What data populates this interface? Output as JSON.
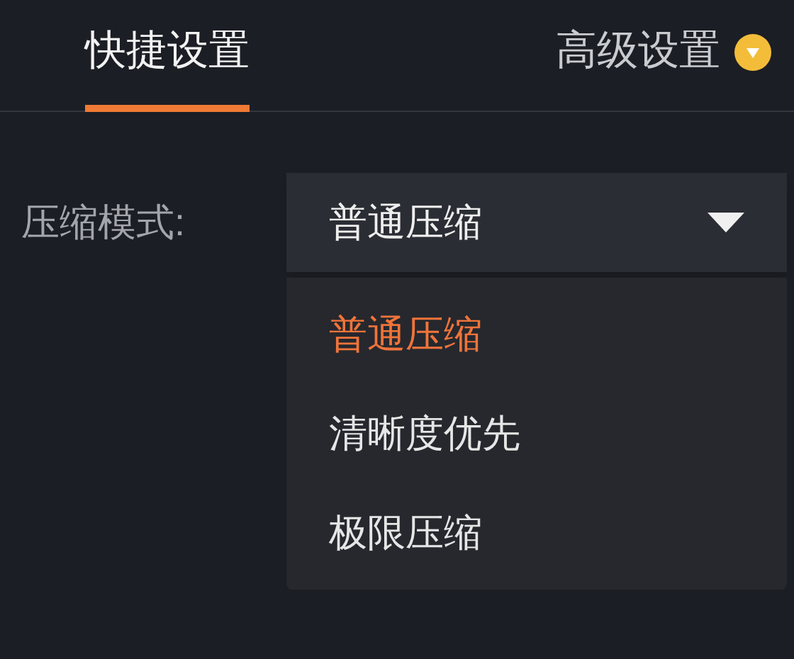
{
  "tabs": [
    {
      "label": "快捷设置",
      "selected": true,
      "badge": false
    },
    {
      "label": "高级设置",
      "selected": false,
      "badge": true
    }
  ],
  "compression": {
    "label": "压缩模式:",
    "value": "普通压缩",
    "expanded": true,
    "options": [
      {
        "label": "普通压缩",
        "selected": true
      },
      {
        "label": "清晰度优先",
        "selected": false
      },
      {
        "label": "极限压缩",
        "selected": false
      }
    ]
  }
}
